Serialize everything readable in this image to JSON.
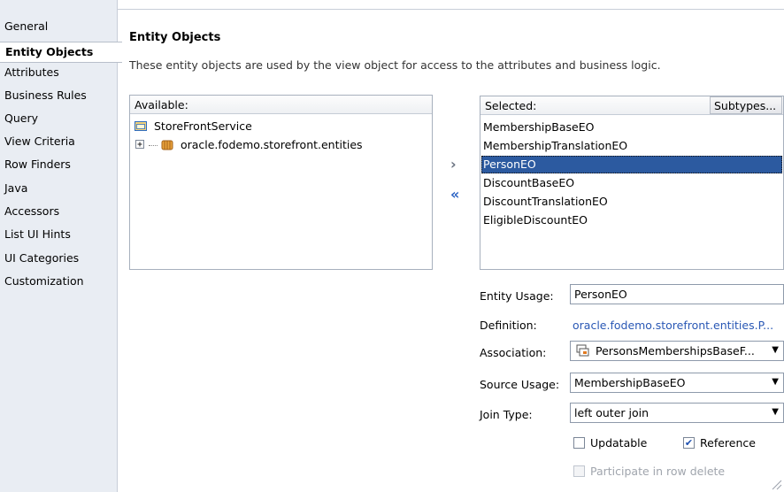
{
  "nav": {
    "items": [
      {
        "label": "General"
      },
      {
        "label": "Entity Objects"
      },
      {
        "label": "Attributes"
      },
      {
        "label": "Business Rules"
      },
      {
        "label": "Query"
      },
      {
        "label": "View Criteria"
      },
      {
        "label": "Row Finders"
      },
      {
        "label": "Java"
      },
      {
        "label": "Accessors"
      },
      {
        "label": "List UI Hints"
      },
      {
        "label": "UI Categories"
      },
      {
        "label": "Customization"
      }
    ],
    "selected": "Entity Objects"
  },
  "section": {
    "title": "Entity Objects",
    "description": "These entity objects are used by the view object for access to the attributes and business logic."
  },
  "available": {
    "header": "Available:",
    "items": [
      {
        "label": "StoreFrontService",
        "icon": "folder-icon"
      },
      {
        "label": "oracle.fodemo.storefront.entities",
        "icon": "package-icon",
        "expander": "+"
      }
    ]
  },
  "shuttle": {
    "add": "›",
    "remove": "«"
  },
  "selected": {
    "header": "Selected:",
    "subtypes_button": "Subtypes...",
    "items": [
      {
        "label": "MembershipBaseEO"
      },
      {
        "label": "MembershipTranslationEO"
      },
      {
        "label": "PersonEO"
      },
      {
        "label": "DiscountBaseEO"
      },
      {
        "label": "DiscountTranslationEO"
      },
      {
        "label": "EligibleDiscountEO"
      }
    ],
    "selected_item": "PersonEO"
  },
  "form": {
    "entity_usage_label": "Entity Usage:",
    "entity_usage_value": "PersonEO",
    "definition_label": "Definition:",
    "definition_value": "oracle.fodemo.storefront.entities.P...",
    "association_label": "Association:",
    "association_value": "PersonsMembershipsBaseF...",
    "source_usage_label": "Source Usage:",
    "source_usage_value": "MembershipBaseEO",
    "join_type_label": "Join Type:",
    "join_type_value": "left outer join",
    "updatable_label": "Updatable",
    "updatable_checked": false,
    "reference_label": "Reference",
    "reference_checked": true,
    "participate_label": "Participate in row delete",
    "participate_checked": false,
    "participate_enabled": false
  },
  "colors": {
    "selection": "#2c5aa0",
    "link": "#2a58b5",
    "nav_background": "#e9edf3"
  }
}
